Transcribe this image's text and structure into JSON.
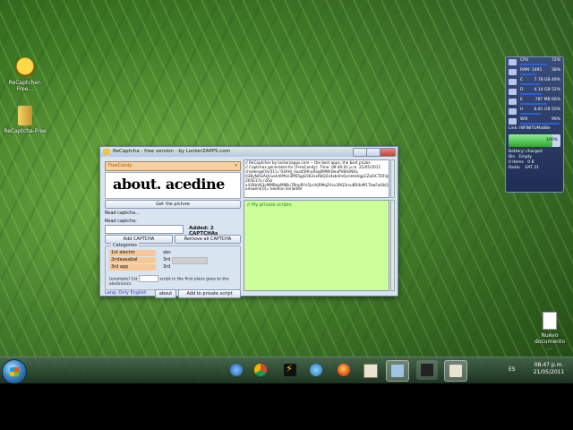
{
  "desktop": {
    "icons": [
      {
        "label": "ReCaptcher-Free..."
      },
      {
        "label": "ReCaptcha-Free"
      },
      {
        "label": "Nuevo documento ..."
      }
    ]
  },
  "gadget": {
    "rows": [
      {
        "label": "CPU",
        "value": "72%"
      },
      {
        "label": "RAM: 1491",
        "value": "38%"
      },
      {
        "label": "C",
        "value": "7.78 GB 49%"
      },
      {
        "label": "D",
        "value": "4.14 GB 52%"
      },
      {
        "label": "E",
        "value": "787 MB 66%"
      },
      {
        "label": "H",
        "value": "6.81 GB 50%"
      },
      {
        "label": "Wifi",
        "value": "99%"
      }
    ],
    "link": "Link: INFINITUMa88e",
    "battery_percent": "100%",
    "battery_status": "Battery: charged",
    "bin_label": "Bin",
    "bin_status": "Empty",
    "bin_items": "0 Items",
    "bin_size": "0 B",
    "radio_label": "Radio",
    "day": "SAT",
    "date": "21"
  },
  "window": {
    "title": "ReCaptcha - free version - by LockerZAPPS.com",
    "service": "FreeCandy",
    "captcha_text": "about. acedine",
    "get_picture": "Get the picture",
    "read_captcha_status": "Read captcha...",
    "read_captcha_label": "Read captcha:",
    "added": "Added: 2 CAPTCHAs",
    "add_captcha": "Add CAPTCHA",
    "remove_all": "Remove all CAPTCHA",
    "categories_title": "Categories",
    "categories": [
      {
        "name": "1st electro",
        "code": "abc"
      },
      {
        "name": "2ndaaaabal",
        "code": "3rd"
      },
      {
        "name": "3rd app",
        "code": "3rd"
      }
    ],
    "example_label": "[example]",
    "example_1st": "1st",
    "example_text": "script in the first place goes to the electronics",
    "footer_lang": "Lang: Only English",
    "about": "about",
    "add_script": "Add to private script",
    "log": "// ReCaptcher by lockerzapps.com -- the best apps, the best prizes\n// Captchas generated for [FreeCandy]  Time: 08:46:01 p.m. 21/05/2011\nchallenge[0x][1]='03AHJ_Vua45HhuRaq0MWrDeuPVBdsNXo\n03ByNAGAQcwvkhlPAzr3M55gjG5K2sxRbQ2sdxb4mQvnHsH/gpCZa0iCTDFsJd8uhFFfq\nZ65E17a n5Sz\nx43SbVK3cMMBepM9Bu7BnpRYv5jvrHjRMq2Vvu3RQ3rcuBR4oM1TkwFwSkQ'\nanswers[0]='oeotion lierladde'",
    "script_placeholder": "// My private scripts"
  },
  "taskbar": {
    "apps": [
      "Windows Live",
      "Google Chrome",
      "Winamp",
      "Internet Explorer",
      "Mozilla Firefox",
      "Windows Explorer",
      "ReCaptcha",
      "Media Player",
      "Notepad"
    ],
    "language": "ES",
    "time": "08:47 p.m.",
    "date": "21/05/2011"
  }
}
